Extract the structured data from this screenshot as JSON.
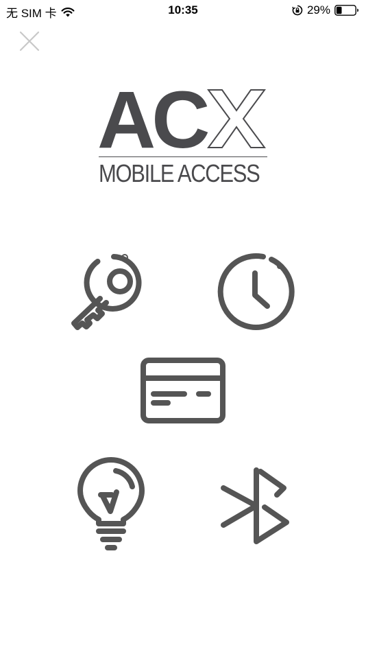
{
  "status_bar": {
    "carrier": "无 SIM 卡",
    "time": "10:35",
    "battery_percent": "29%",
    "battery_level": 0.29,
    "icons": [
      "wifi-icon",
      "rotation-lock-icon",
      "battery-icon"
    ]
  },
  "header": {
    "close_icon": "close-icon"
  },
  "logo": {
    "main_text": "AC",
    "x_letter": "X",
    "subtitle": "MOBILE ACCESS"
  },
  "features": [
    {
      "icon": "key-icon"
    },
    {
      "icon": "clock-icon"
    },
    {
      "icon": "card-icon"
    },
    {
      "icon": "lightbulb-icon"
    },
    {
      "icon": "bluetooth-icon"
    }
  ],
  "colors": {
    "icon": "#555555",
    "logo": "#4a4a4d",
    "close": "#c8c8c8",
    "text": "#000000"
  }
}
